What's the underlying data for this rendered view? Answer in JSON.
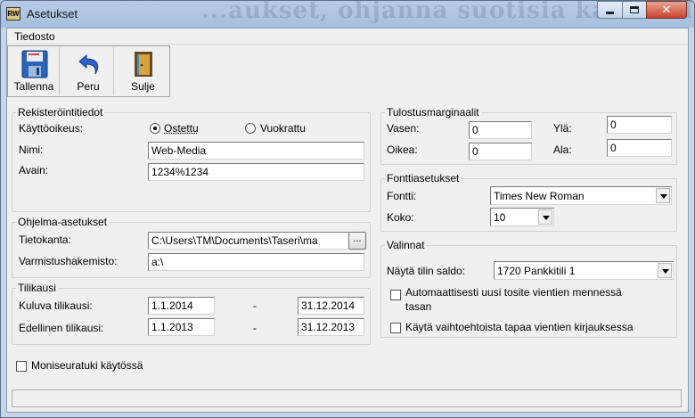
{
  "window": {
    "title": "Asetukset",
    "icon_text": "RW",
    "background_ghost_text": "...aukset, ohjanna suotisia kaikki. Tanan kasteen"
  },
  "menu": {
    "file": "Tiedosto"
  },
  "toolbar": {
    "save": "Tallenna",
    "undo": "Peru",
    "close": "Sulje"
  },
  "registration": {
    "legend": "Rekisteröintitiedot",
    "license_label": "Käyttöoikeus:",
    "option_bought": "Ostettu",
    "option_rented": "Vuokrattu",
    "selected": "Ostettu",
    "name_label": "Nimi:",
    "name_value": "Web-Media",
    "key_label": "Avain:",
    "key_value": "1234%1234"
  },
  "program": {
    "legend": "Ohjelma-asetukset",
    "database_label": "Tietokanta:",
    "database_value": "C:\\Users\\TM\\Documents\\Taseri\\ma",
    "browse_label": "...",
    "backup_label": "Varmistushakemisto:",
    "backup_value": "a:\\"
  },
  "fiscal": {
    "legend": "Tilikausi",
    "current_label": "Kuluva tilikausi:",
    "current_start": "1.1.2014",
    "current_end": "31.12.2014",
    "previous_label": "Edellinen tilikausi:",
    "previous_start": "1.1.2013",
    "previous_end": "31.12.2013",
    "dash": "-"
  },
  "margins": {
    "legend": "Tulostusmarginaalit",
    "left_label": "Vasen:",
    "left_value": "0",
    "top_label": "Ylä:",
    "top_value": "0",
    "right_label": "Oikea:",
    "right_value": "0",
    "bottom_label": "Ala:",
    "bottom_value": "0"
  },
  "fonts": {
    "legend": "Fonttiasetukset",
    "font_label": "Fontti:",
    "font_value": "Times New Roman",
    "size_label": "Koko:",
    "size_value": "10"
  },
  "options": {
    "legend": "Valinnat",
    "balance_label": "Näytä tilin saldo:",
    "balance_value": "1720 Pankkitili 1",
    "auto_voucher_line1": "Automaattisesti uusi tosite vientien mennessä",
    "auto_voucher_line2": "tasan",
    "alt_entry": "Käytä vaihtoehtoista tapaa vientien kirjauksessa"
  },
  "multi_company": "Moniseuratuki käytössä"
}
